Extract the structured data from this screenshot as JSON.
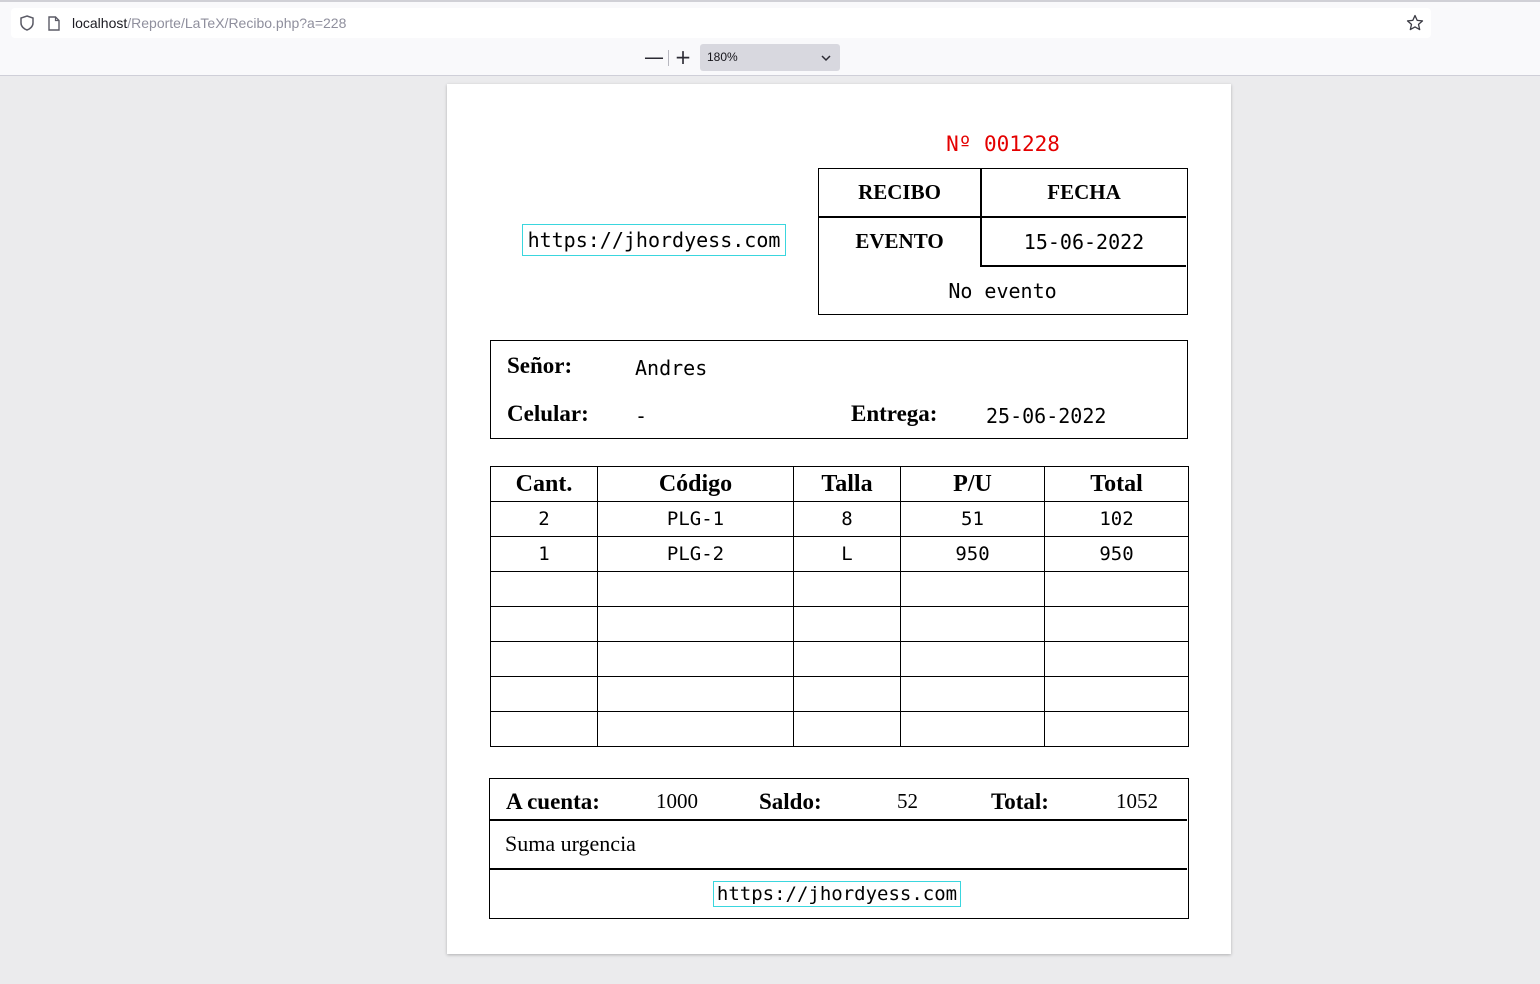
{
  "browser": {
    "url_host": "localhost",
    "url_path": "/Reporte/LaTeX/Recibo.php?a=228",
    "icons": {
      "security": "shield-icon",
      "page": "page-icon",
      "bookmark": "star-icon"
    }
  },
  "pdf_toolbar": {
    "zoom_out_label": "—",
    "zoom_in_label": "+",
    "zoom_value": "180%",
    "zoom_chevron": "chevron-down-icon"
  },
  "receipt": {
    "number": "Nº 001228",
    "site_link": "https://jhordyess.com",
    "header": {
      "recibo_label": "RECIBO",
      "fecha_label": "FECHA",
      "evento_label": "EVENTO",
      "fecha_value": "15-06-2022",
      "evento_value": "No evento"
    },
    "client": {
      "senor_label": "Señor:",
      "senor_value": "Andres",
      "celular_label": "Celular:",
      "celular_value": "-",
      "entrega_label": "Entrega:",
      "entrega_value": "25-06-2022"
    },
    "items": {
      "columns": [
        "Cant.",
        "Código",
        "Talla",
        "P/U",
        "Total"
      ],
      "rows": [
        [
          "2",
          "PLG-1",
          "8",
          "51",
          "102"
        ],
        [
          "1",
          "PLG-2",
          "L",
          "950",
          "950"
        ],
        [
          "",
          "",
          "",
          "",
          ""
        ],
        [
          "",
          "",
          "",
          "",
          ""
        ],
        [
          "",
          "",
          "",
          "",
          ""
        ],
        [
          "",
          "",
          "",
          "",
          ""
        ],
        [
          "",
          "",
          "",
          "",
          ""
        ]
      ]
    },
    "totals": {
      "a_cuenta_label": "A cuenta:",
      "a_cuenta_value": "1000",
      "saldo_label": "Saldo:",
      "saldo_value": "52",
      "total_label": "Total:",
      "total_value": "1052",
      "note": "Suma urgencia"
    }
  }
}
